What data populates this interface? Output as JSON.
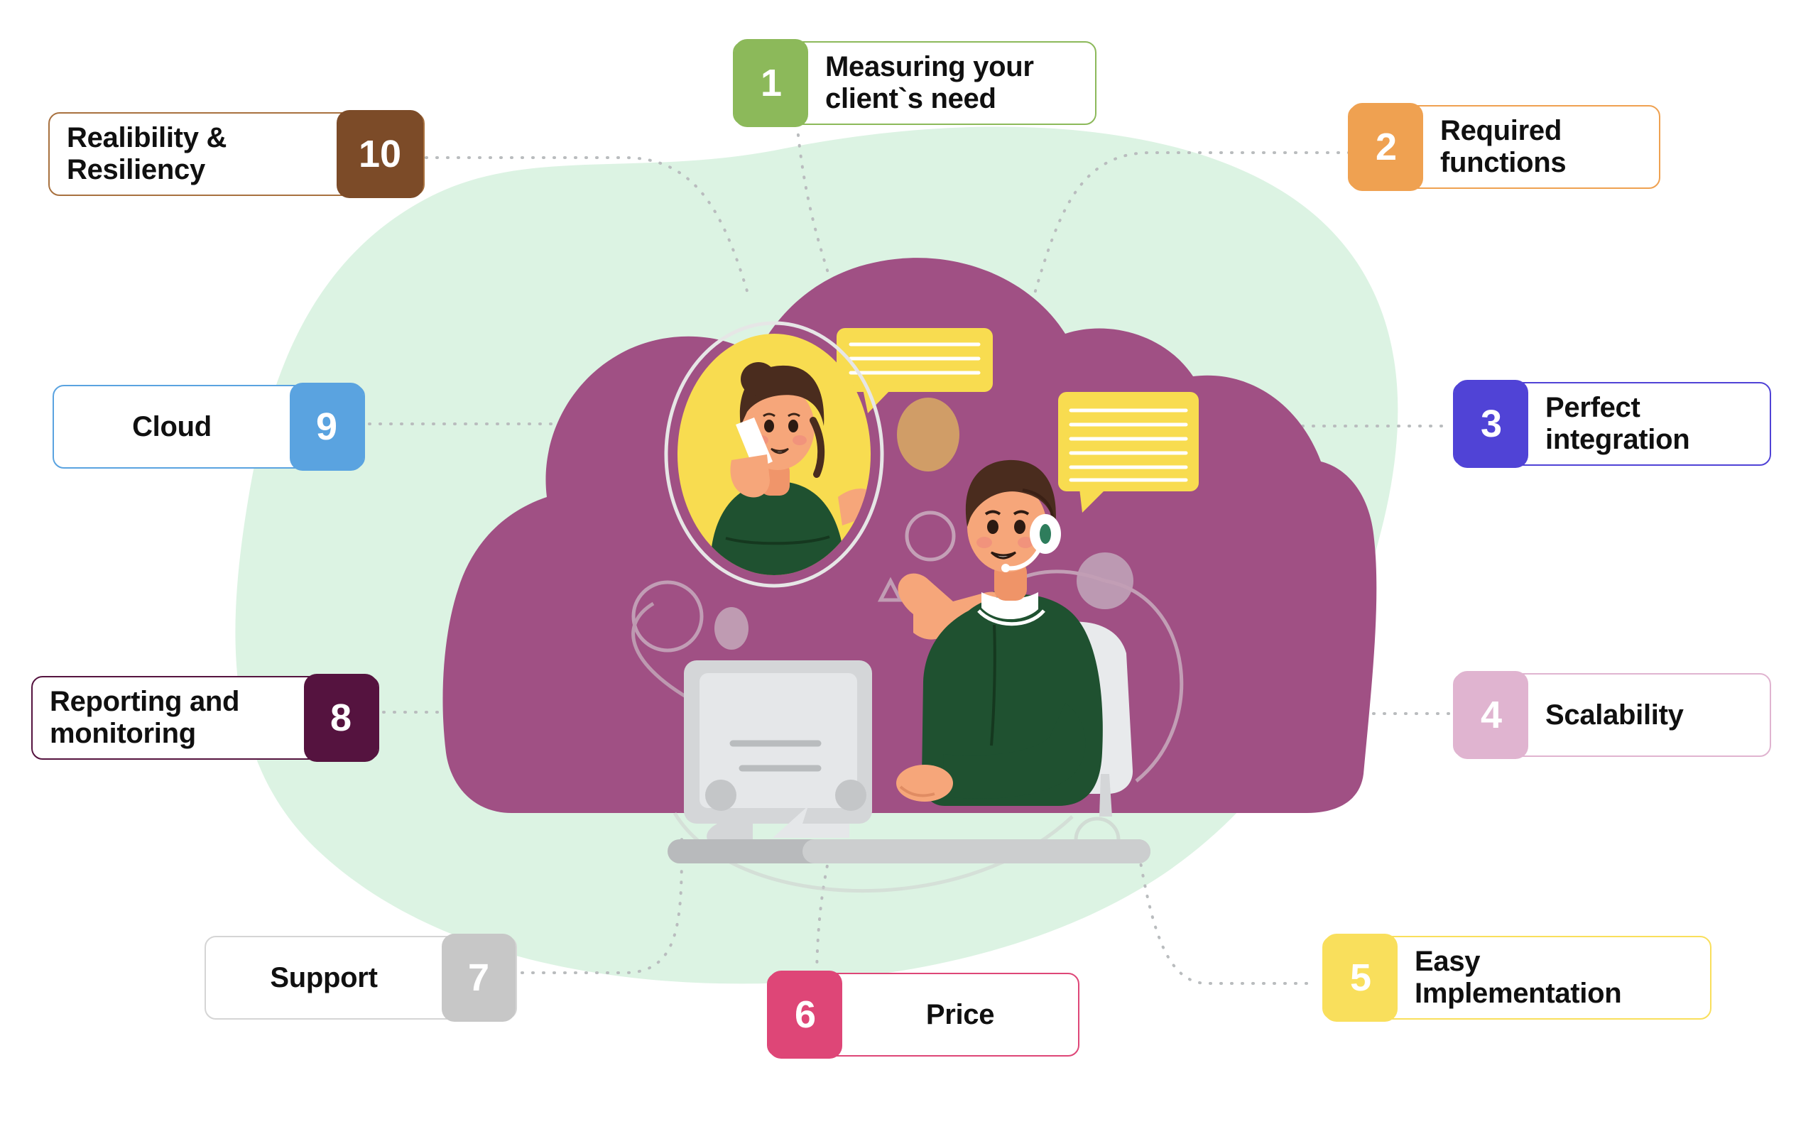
{
  "diagram": {
    "type": "radial-numbered-list",
    "title_visible": false,
    "item_count": 10,
    "center_illustration": "call-center-agent-with-client-in-cloud",
    "colors": {
      "background": "#ffffff",
      "green_blob": "#dcf3e3",
      "purple_cloud": "#a05084",
      "yellow_accent": "#f8dc50",
      "green_shirt": "#1f5130",
      "skin": "#f6a67a",
      "hair": "#4a2c1e",
      "device_gray": "#d4d6d8",
      "connector_line": "#b9bcbe"
    }
  },
  "items": [
    {
      "number": "1",
      "label": "Measuring your\nclient`s need",
      "badge_color": "#8cb95a",
      "border_color": "#8cb95a",
      "badge_side": "left"
    },
    {
      "number": "2",
      "label": "Required\nfunctions",
      "badge_color": "#efa151",
      "border_color": "#efa151",
      "badge_side": "left"
    },
    {
      "number": "3",
      "label": "Perfect\nintegration",
      "badge_color": "#5043d6",
      "border_color": "#5043d6",
      "badge_side": "left"
    },
    {
      "number": "4",
      "label": "Scalability",
      "badge_color": "#e0b4d0",
      "border_color": "#e0b4d0",
      "badge_side": "left"
    },
    {
      "number": "5",
      "label": "Easy\nImplementation",
      "badge_color": "#f9df5c",
      "border_color": "#f9df5c",
      "badge_side": "left"
    },
    {
      "number": "6",
      "label": "Price",
      "badge_color": "#de4677",
      "border_color": "#de4677",
      "badge_side": "left"
    },
    {
      "number": "7",
      "label": "Support",
      "badge_color": "#c7c7c7",
      "border_color": "#d5d5d5",
      "badge_side": "right"
    },
    {
      "number": "8",
      "label": "Reporting and\nmonitoring",
      "badge_color": "#55133f",
      "border_color": "#55133f",
      "badge_side": "right"
    },
    {
      "number": "9",
      "label": "Cloud",
      "badge_color": "#5aa3e0",
      "border_color": "#5aa3e0",
      "badge_side": "right"
    },
    {
      "number": "10",
      "label": "Realibility &\nResiliency",
      "badge_color": "#7c4b28",
      "border_color": "#a8713f",
      "badge_side": "right"
    }
  ]
}
